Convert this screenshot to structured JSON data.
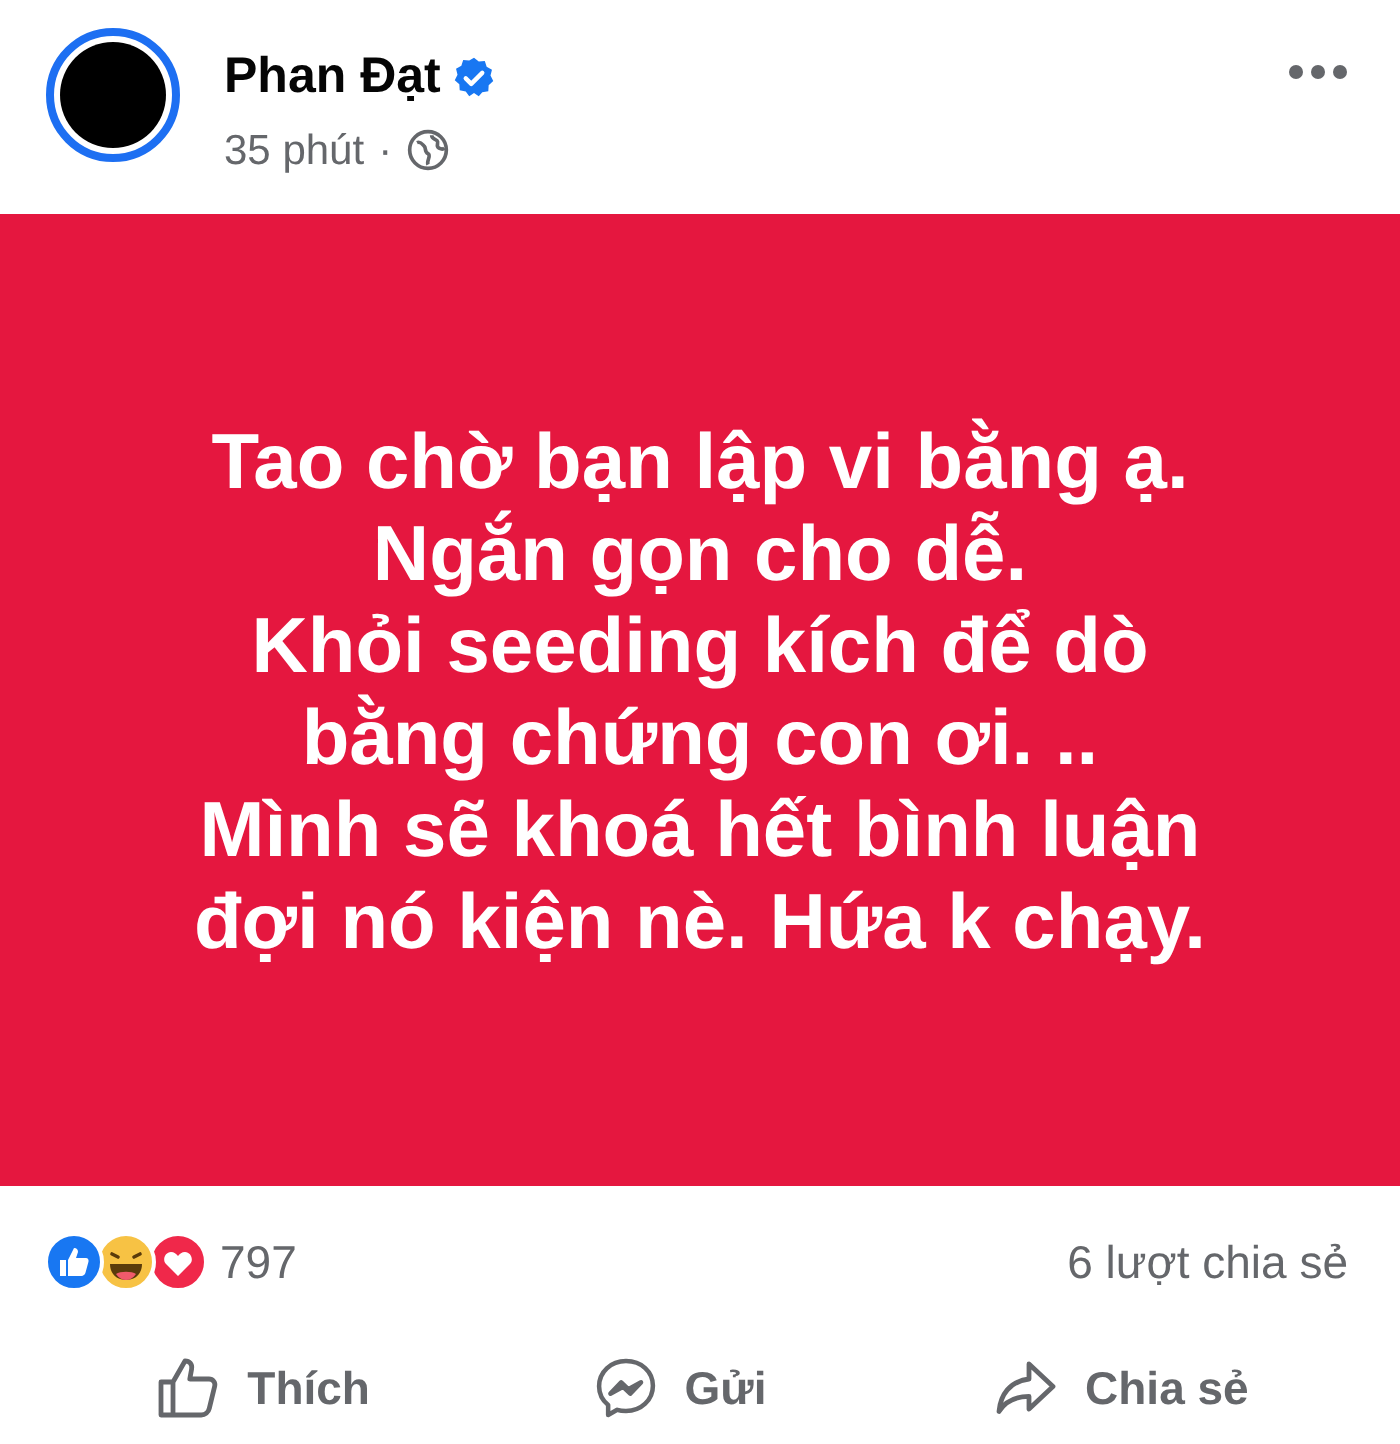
{
  "author": {
    "name": "Phan Đạt",
    "verified": true
  },
  "meta": {
    "time": "35 phút",
    "separator": "·"
  },
  "post_lines": [
    "Tao chờ bạn lập vi bằng ạ.",
    "Ngắn gọn cho dễ.",
    "Khỏi seeding kích để dò",
    "bằng chứng con ơi. ..",
    "Mình sẽ khoá hết bình luận",
    "đợi nó kiện nè. Hứa k chạy."
  ],
  "reactions": [
    {
      "kind": "like"
    },
    {
      "kind": "haha"
    },
    {
      "kind": "love"
    }
  ],
  "reaction_count": "797",
  "shares": "6 lượt chia sẻ",
  "actions": [
    {
      "kind": "like",
      "label": "Thích"
    },
    {
      "kind": "send",
      "label": "Gửi"
    },
    {
      "kind": "share",
      "label": "Chia sẻ"
    }
  ]
}
